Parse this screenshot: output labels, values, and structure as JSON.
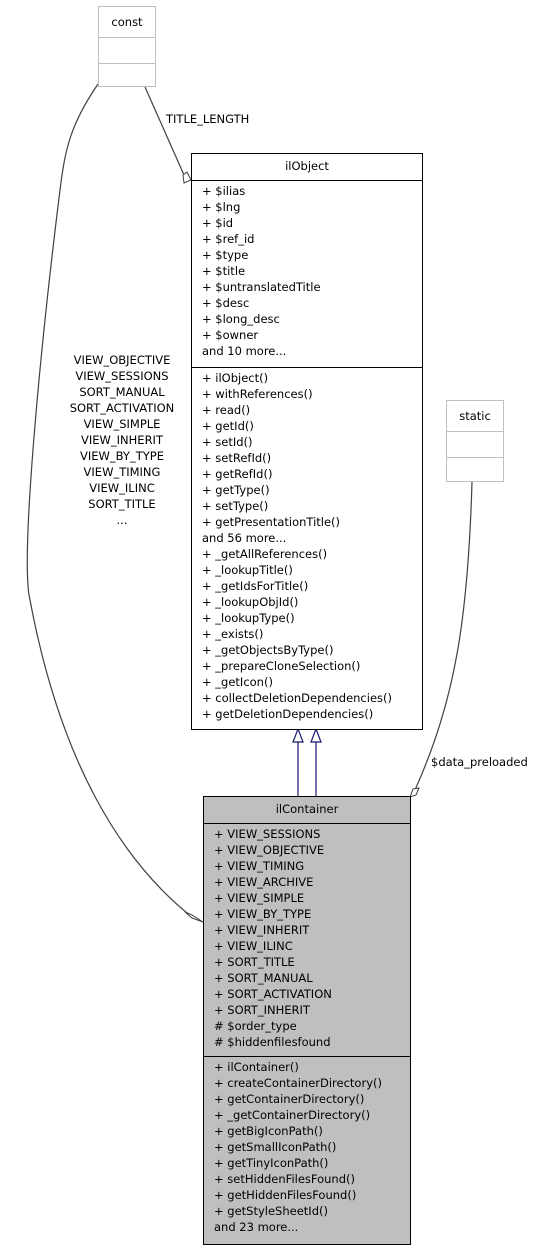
{
  "classes": {
    "const": {
      "name": "const"
    },
    "static": {
      "name": "static"
    },
    "ilObject": {
      "name": "ilObject",
      "attributes": [
        "+ $ilias",
        "+ $lng",
        "+ $id",
        "+ $ref_id",
        "+ $type",
        "+ $title",
        "+ $untranslatedTitle",
        "+ $desc",
        "+ $long_desc",
        "+ $owner",
        "and 10 more..."
      ],
      "methods": [
        "+ ilObject()",
        "+ withReferences()",
        "+ read()",
        "+ getId()",
        "+ setId()",
        "+ setRefId()",
        "+ getRefId()",
        "+ getType()",
        "+ setType()",
        "+ getPresentationTitle()",
        "and 56 more...",
        "+ _getAllReferences()",
        "+ _lookupTitle()",
        "+ _getIdsForTitle()",
        "+ _lookupObjId()",
        "+ _lookupType()",
        "+ _exists()",
        "+ _getObjectsByType()",
        "+ _prepareCloneSelection()",
        "+ _getIcon()",
        "+ collectDeletionDependencies()",
        "+ getDeletionDependencies()"
      ]
    },
    "ilContainer": {
      "name": "ilContainer",
      "attributes": [
        "+ VIEW_SESSIONS",
        "+ VIEW_OBJECTIVE",
        "+ VIEW_TIMING",
        "+ VIEW_ARCHIVE",
        "+ VIEW_SIMPLE",
        "+ VIEW_BY_TYPE",
        "+ VIEW_INHERIT",
        "+ VIEW_ILINC",
        "+ SORT_TITLE",
        "+ SORT_MANUAL",
        "+ SORT_ACTIVATION",
        "+ SORT_INHERIT",
        "# $order_type",
        "# $hiddenfilesfound"
      ],
      "methods": [
        "+ ilContainer()",
        "+ createContainerDirectory()",
        "+ getContainerDirectory()",
        "+ _getContainerDirectory()",
        "+ getBigIconPath()",
        "+ getSmallIconPath()",
        "+ getTinyIconPath()",
        "+ setHiddenFilesFound()",
        "+ getHiddenFilesFound()",
        "+ getStyleSheetId()",
        "and 23 more..."
      ]
    }
  },
  "edge_labels": {
    "title_length": "TITLE_LENGTH",
    "data_preloaded": "$data_preloaded",
    "const_to_container": [
      "VIEW_OBJECTIVE",
      "VIEW_SESSIONS",
      "SORT_MANUAL",
      "SORT_ACTIVATION",
      "VIEW_SIMPLE",
      "VIEW_INHERIT",
      "VIEW_BY_TYPE",
      "VIEW_TIMING",
      "VIEW_ILINC",
      "SORT_TITLE",
      "..."
    ]
  },
  "colors": {
    "inheritance_edge": "#191970",
    "association_edge": "#404040",
    "focus_fill": "#bfbfbf",
    "ghost_border": "#bfbfbf"
  }
}
